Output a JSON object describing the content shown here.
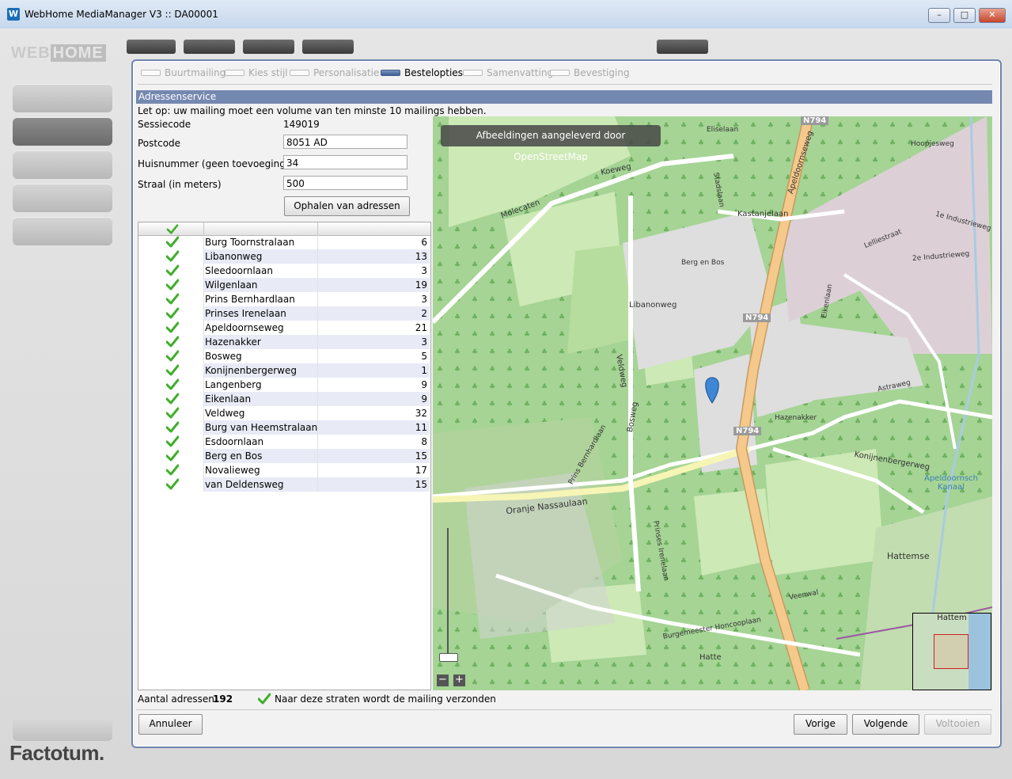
{
  "window": {
    "title": "WebHome MediaManager V3 :: DA00001",
    "logo_letter": "W",
    "minimize": "–",
    "maximize": "□",
    "close": "✕"
  },
  "branding": {
    "bottom_logo": "Factotum."
  },
  "wizard": {
    "steps": [
      {
        "label": "Buurtmailing",
        "active": false
      },
      {
        "label": "Kies stijl",
        "active": false
      },
      {
        "label": "Personalisatie",
        "active": false
      },
      {
        "label": "Bestelopties",
        "active": true
      },
      {
        "label": "Samenvatting",
        "active": false
      },
      {
        "label": "Bevestiging",
        "active": false
      }
    ],
    "section_title": "Adressenservice",
    "note": "Let op: uw mailing moet een volume van ten minste 10 mailings hebben.",
    "session": {
      "label": "Sessiecode",
      "value": "149019"
    },
    "postcode": {
      "label": "Postcode",
      "value": "8051 AD"
    },
    "housenumber": {
      "label": "Huisnummer (geen toevoeging):",
      "value": "34"
    },
    "radius": {
      "label": "Straal (in meters)",
      "value": "500"
    },
    "fetch_button": "Ophalen van adressen",
    "streets": [
      {
        "name": "Burg Toornstralaan",
        "count": "6"
      },
      {
        "name": "Libanonweg",
        "count": "13"
      },
      {
        "name": "Sleedoornlaan",
        "count": "3"
      },
      {
        "name": "Wilgenlaan",
        "count": "19"
      },
      {
        "name": "Prins Bernhardlaan",
        "count": "3"
      },
      {
        "name": "Prinses Irenelaan",
        "count": "2"
      },
      {
        "name": "Apeldoornseweg",
        "count": "21"
      },
      {
        "name": "Hazenakker",
        "count": "3"
      },
      {
        "name": "Bosweg",
        "count": "5"
      },
      {
        "name": "Konijnenbergerweg",
        "count": "1"
      },
      {
        "name": "Langenberg",
        "count": "9"
      },
      {
        "name": "Eikenlaan",
        "count": "9"
      },
      {
        "name": "Veldweg",
        "count": "32"
      },
      {
        "name": "Burg van Heemstralaan",
        "count": "11"
      },
      {
        "name": "Esdoornlaan",
        "count": "8"
      },
      {
        "name": "Berg en Bos",
        "count": "15"
      },
      {
        "name": "Novalieweg",
        "count": "17"
      },
      {
        "name": "van Deldensweg",
        "count": "15"
      }
    ],
    "map": {
      "attribution": "Afbeeldingen aangeleverd door OpenStreetMap",
      "zoom_in": "+",
      "zoom_out": "−",
      "minimap_label": "Hattem",
      "labels": [
        "Apeldoornseweg",
        "Kastanjelaan",
        "Koeweg",
        "Molecaten",
        "Veldweg",
        "Libanonweg",
        "Bosweg",
        "Oranje Nassaulaan",
        "Konijnenbergerweg",
        "Hattemse",
        "Apeldoornsch Kanaal",
        "Hazenakker",
        "Astraweg",
        "N794",
        "Burgemeester Honcooplaan",
        "Veenwal",
        "Eliselaan",
        "Berg en Bos",
        "Eikenlaan",
        "Hoopjesweg",
        "1e Industrieweg",
        "2e Industrieweg",
        "Lelliestraat",
        "Prinses Irenelaan",
        "Prins Bernhardlaan",
        "Stadslaan",
        "Hatte"
      ]
    },
    "footer": {
      "count_label": "Aantal adressen",
      "count_value": "192",
      "legend": "Naar deze straten wordt de mailing verzonden"
    },
    "buttons": {
      "cancel": "Annuleer",
      "previous": "Vorige",
      "next": "Volgende",
      "finish": "Voltooien"
    }
  },
  "colors": {
    "section_header": "#7588b0",
    "dialog_border": "#6f84ad",
    "check": "#3fae2a",
    "map_forest": "#a5d495",
    "map_residential": "#dedede",
    "map_road_primary": "#f5c98b"
  }
}
